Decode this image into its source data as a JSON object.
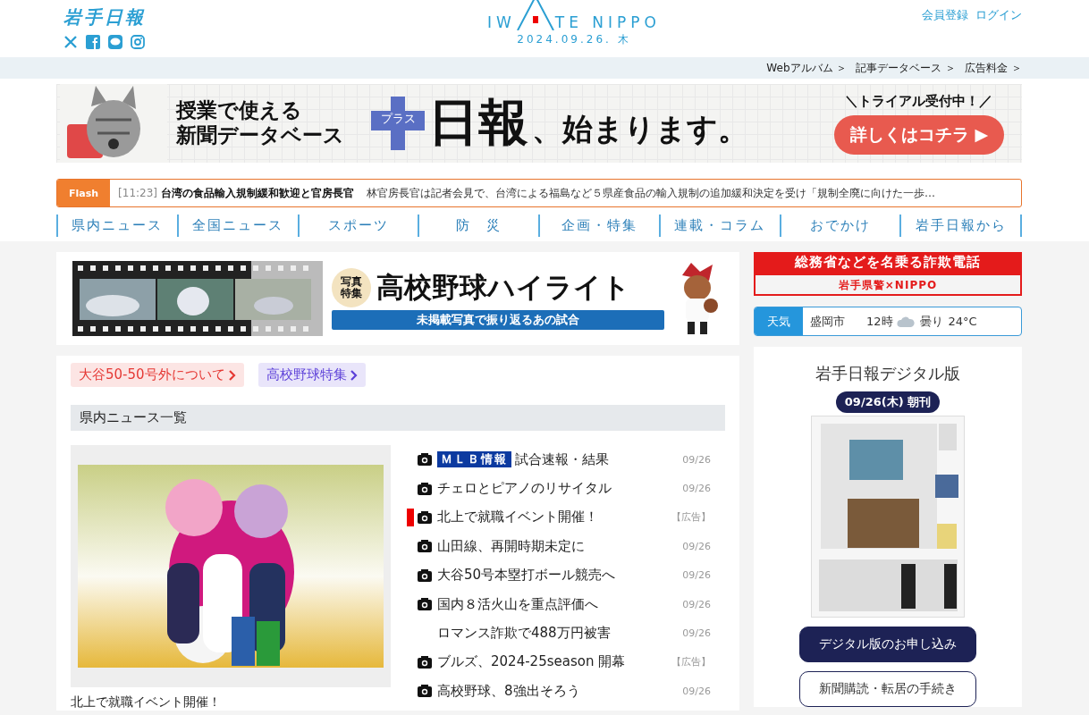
{
  "header": {
    "logo": "岩手日報",
    "site_logo_left": "IW",
    "site_logo_right": "TE NIPPO",
    "date": "2024.09.26. 木",
    "account_links": [
      "会員登録",
      "ログイン"
    ]
  },
  "breadcrumb": [
    "Webアルバム ＞",
    "記事データベース ＞",
    "広告料金 ＞"
  ],
  "promo_banner": {
    "lines": [
      "授業で使える",
      "新聞データベース"
    ],
    "plus_label": "プラス",
    "name": "日報",
    "tail": "、始まります。",
    "note": "＼トライアル受付中！／",
    "button": "詳しくはコチラ ▶"
  },
  "flash": {
    "label": "Flash",
    "time": "[11:23]",
    "headline": "台湾の食品輸入規制緩和歓迎と官房長官",
    "summary": "林官房長官は記者会見で、台湾による福島など５県産食品の輸入規制の追加緩和決定を受け「規制全廃に向けた一歩…"
  },
  "nav": [
    "県内ニュース",
    "全国ニュース",
    "スポーツ",
    "防　災",
    "企画・特集",
    "連載・コラム",
    "おでかけ",
    "岩手日報から"
  ],
  "feature_banner": {
    "badge": [
      "写真",
      "特集"
    ],
    "title": "高校野球ハイライト",
    "subtitle": "未掲載写真で振り返るあの試合"
  },
  "tags": [
    {
      "label": "大谷50-50号外について",
      "color": "#e53935"
    },
    {
      "label": "高校野球特集",
      "color": "#5b3fd8"
    }
  ],
  "section_title": "県内ニュース一覧",
  "featured": {
    "kind": "picture",
    "caption": "北上で就職イベント開催！"
  },
  "news": [
    {
      "tag": "ＭＬＢ情報",
      "title": "試合速報・結果",
      "date": "09/26",
      "photo": true,
      "highlighted": false
    },
    {
      "title": "チェロとピアノのリサイタル",
      "date": "09/26",
      "photo": true,
      "highlighted": false
    },
    {
      "title": "北上で就職イベント開催！",
      "date": "【広告】",
      "photo": true,
      "highlighted": true
    },
    {
      "title": "山田線、再開時期未定に",
      "date": "09/26",
      "photo": true,
      "highlighted": false
    },
    {
      "title": "大谷50号本塁打ボール競売へ",
      "date": "09/26",
      "photo": true,
      "highlighted": false
    },
    {
      "title": "国内８活火山を重点評価へ",
      "date": "09/26",
      "photo": true,
      "highlighted": false
    },
    {
      "title": "ロマンス詐欺で488万円被害",
      "date": "09/26",
      "photo": false,
      "highlighted": false
    },
    {
      "title": "ブルズ、2024-25season 開幕",
      "date": "【広告】",
      "photo": true,
      "highlighted": false
    },
    {
      "title": "高校野球、8強出そろう",
      "date": "09/26",
      "photo": true,
      "highlighted": false
    }
  ],
  "alert_banner": {
    "title": "総務省などを名乗る詐欺電話",
    "subtitle": "岩手県警×NIPPO"
  },
  "weather": {
    "label": "天気",
    "city": "盛岡市",
    "time": "12時",
    "condition": "曇り",
    "temperature": "24°C"
  },
  "digital": {
    "title": "岩手日報デジタル版",
    "edition": "09/26(木) 朝刊",
    "buttons": [
      {
        "label": "デジタル版のお申し込み",
        "kind": "primary"
      },
      {
        "label": "新聞購読・転居の手続き",
        "kind": "outline"
      }
    ]
  }
}
